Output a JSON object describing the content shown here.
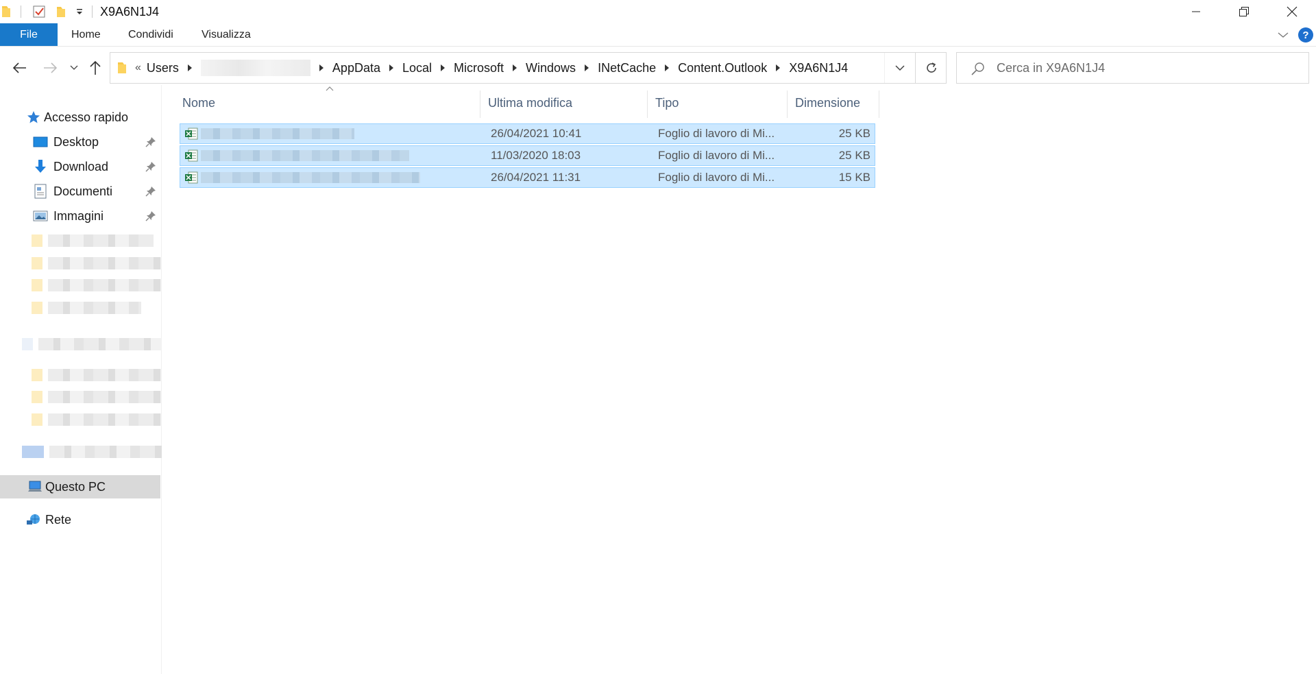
{
  "window": {
    "title": "X9A6N1J4",
    "minimize_label": "Riduci a icona",
    "restore_label": "Ripristina",
    "close_label": "Chiudi"
  },
  "ribbon": {
    "tabs": [
      {
        "label": "File"
      },
      {
        "label": "Home"
      },
      {
        "label": "Condividi"
      },
      {
        "label": "Visualizza"
      }
    ],
    "help": "?"
  },
  "address": {
    "overflow": "«",
    "crumbs": [
      "Users",
      "AppData",
      "Local",
      "Microsoft",
      "Windows",
      "INetCache",
      "Content.Outlook",
      "X9A6N1J4"
    ]
  },
  "search": {
    "placeholder": "Cerca in X9A6N1J4"
  },
  "sidebar": {
    "quick_access": "Accesso rapido",
    "pinned": [
      {
        "label": "Desktop",
        "icon": "desktop-icon"
      },
      {
        "label": "Download",
        "icon": "download-icon"
      },
      {
        "label": "Documenti",
        "icon": "documents-icon"
      },
      {
        "label": "Immagini",
        "icon": "pictures-icon"
      }
    ],
    "this_pc": "Questo PC",
    "network": "Rete"
  },
  "filelist": {
    "columns": {
      "name": "Nome",
      "modified": "Ultima modifica",
      "type": "Tipo",
      "size": "Dimensione"
    },
    "rows": [
      {
        "modified": "26/04/2021 10:41",
        "type": "Foglio di lavoro di Mi...",
        "size": "25 KB"
      },
      {
        "modified": "11/03/2020 18:03",
        "type": "Foglio di lavoro di Mi...",
        "size": "25 KB"
      },
      {
        "modified": "26/04/2021 11:31",
        "type": "Foglio di lavoro di Mi...",
        "size": "15 KB"
      }
    ]
  },
  "colors": {
    "accent": "#1979ca",
    "selection": "#cce8ff",
    "selection_border": "#99d1ff",
    "header_text": "#4c607a"
  }
}
